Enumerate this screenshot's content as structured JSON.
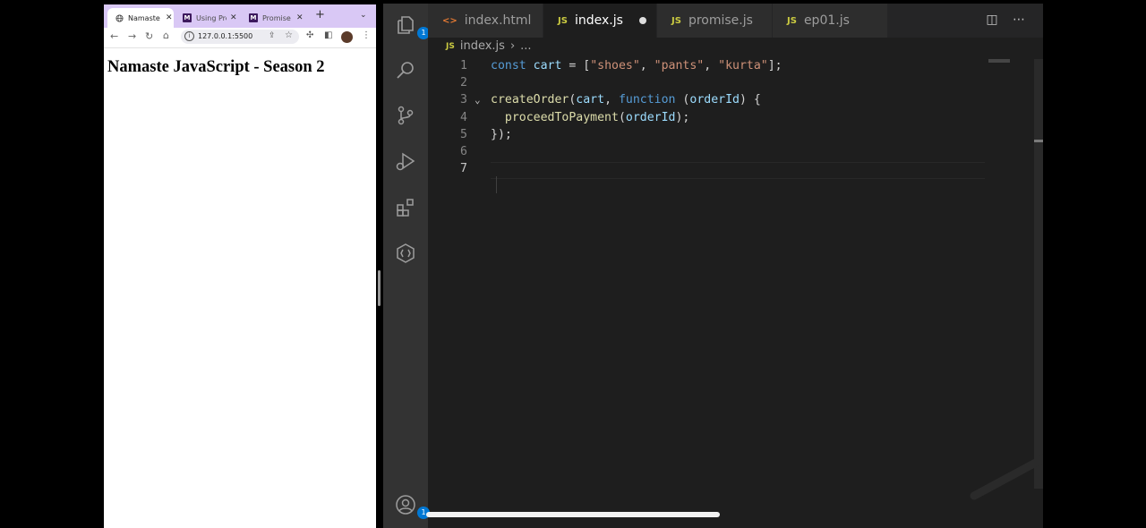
{
  "browser": {
    "tabs": [
      {
        "title": "Namaste",
        "active": true,
        "icon": "globe-icon"
      },
      {
        "title": "Using Pro",
        "active": false,
        "icon": "mdn-icon"
      },
      {
        "title": "Promise",
        "active": false,
        "icon": "mdn-icon"
      }
    ],
    "url": "127.0.0.1:5500",
    "page_heading": "Namaste JavaScript - Season 2"
  },
  "vscode": {
    "tabs": [
      {
        "label": "index.html",
        "icon": "html-file-icon",
        "icon_text": "<>",
        "active": false
      },
      {
        "label": "index.js",
        "icon": "js-file-icon",
        "icon_text": "JS",
        "active": true,
        "unsaved": true
      },
      {
        "label": "promise.js",
        "icon": "js-file-icon",
        "icon_text": "JS",
        "active": false
      },
      {
        "label": "ep01.js",
        "icon": "js-file-icon",
        "icon_text": "JS",
        "active": false
      }
    ],
    "breadcrumb": {
      "icon_text": "JS",
      "file": "index.js",
      "rest": "..."
    },
    "explorer_badge": "1",
    "accounts_badge": "1",
    "code_lines": [
      {
        "num": "1",
        "tokens": [
          [
            "kw",
            "const"
          ],
          [
            "pl",
            " "
          ],
          [
            "var",
            "cart"
          ],
          [
            "pl",
            " = ["
          ],
          [
            "str",
            "\"shoes\""
          ],
          [
            "pl",
            ", "
          ],
          [
            "str",
            "\"pants\""
          ],
          [
            "pl",
            ", "
          ],
          [
            "str",
            "\"kurta\""
          ],
          [
            "pl",
            "];"
          ]
        ]
      },
      {
        "num": "2",
        "tokens": []
      },
      {
        "num": "3",
        "tokens": [
          [
            "fn",
            "createOrder"
          ],
          [
            "pl",
            "("
          ],
          [
            "var",
            "cart"
          ],
          [
            "pl",
            ", "
          ],
          [
            "kw",
            "function"
          ],
          [
            "pl",
            " ("
          ],
          [
            "var",
            "orderId"
          ],
          [
            "pl",
            ") {"
          ]
        ]
      },
      {
        "num": "4",
        "tokens": [
          [
            "pl",
            "  "
          ],
          [
            "fn",
            "proceedToPayment"
          ],
          [
            "pl",
            "("
          ],
          [
            "var",
            "orderId"
          ],
          [
            "pl",
            ");"
          ]
        ]
      },
      {
        "num": "5",
        "tokens": [
          [
            "pl",
            "});"
          ]
        ]
      },
      {
        "num": "6",
        "tokens": []
      },
      {
        "num": "7",
        "tokens": []
      }
    ],
    "current_line": "7"
  },
  "colors": {
    "tab_strip": "#d9c8f5",
    "editor_bg": "#1e1e1e",
    "activity_bar": "#333333",
    "badge": "#0078d4",
    "keyword": "#569cd6",
    "variable": "#9cdcfe",
    "string": "#ce9178",
    "function": "#dcdcaa"
  }
}
